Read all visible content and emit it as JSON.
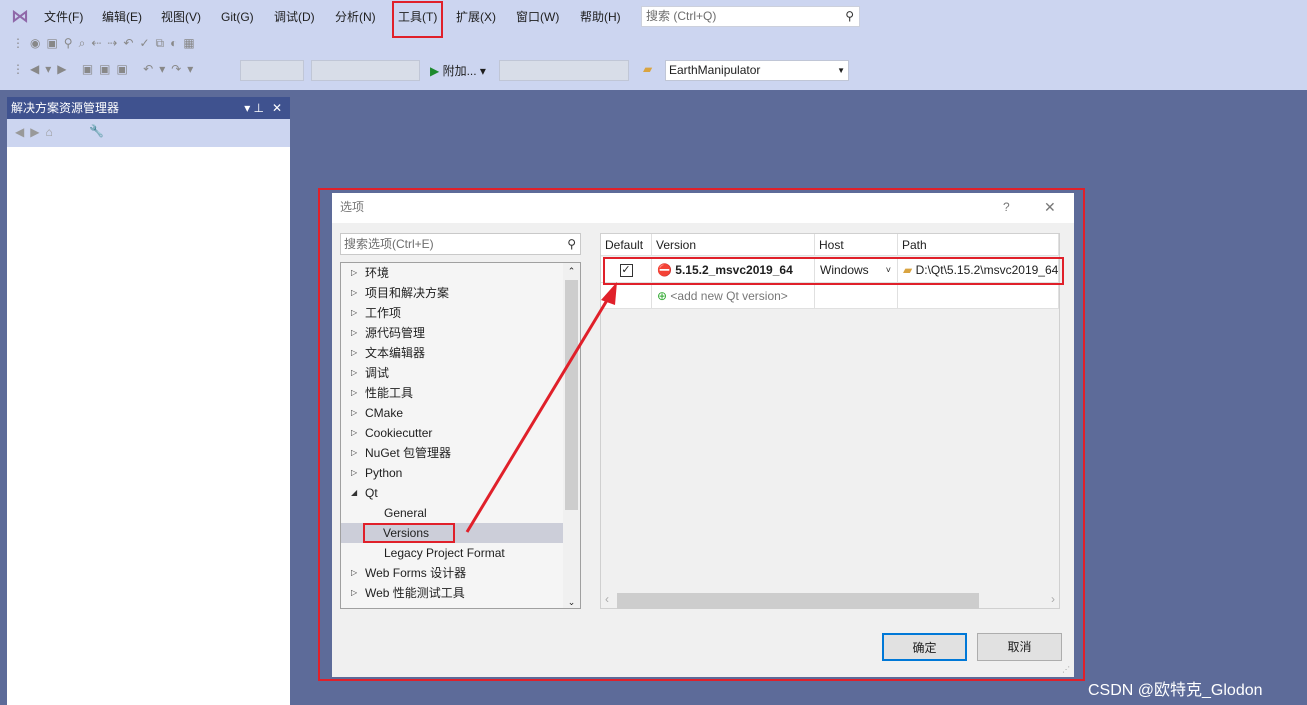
{
  "menu": [
    "文件(F)",
    "编辑(E)",
    "视图(V)",
    "Git(G)",
    "调试(D)",
    "分析(N)",
    "工具(T)",
    "扩展(X)",
    "窗口(W)",
    "帮助(H)"
  ],
  "search_placeholder": "搜索 (Ctrl+Q)",
  "toolbar": {
    "attach_label": "附加...",
    "startup_project": "EarthManipulator"
  },
  "solution_explorer": {
    "title": "解决方案资源管理器"
  },
  "dialog": {
    "title": "选项",
    "help": "?",
    "close": "✕",
    "search_placeholder": "搜索选项(Ctrl+E)",
    "tree": [
      {
        "label": "环境",
        "expanded": false
      },
      {
        "label": "项目和解决方案",
        "expanded": false
      },
      {
        "label": "工作项",
        "expanded": false
      },
      {
        "label": "源代码管理",
        "expanded": false
      },
      {
        "label": "文本编辑器",
        "expanded": false
      },
      {
        "label": "调试",
        "expanded": false
      },
      {
        "label": "性能工具",
        "expanded": false
      },
      {
        "label": "CMake",
        "expanded": false
      },
      {
        "label": "Cookiecutter",
        "expanded": false
      },
      {
        "label": "NuGet 包管理器",
        "expanded": false
      },
      {
        "label": "Python",
        "expanded": false
      },
      {
        "label": "Qt",
        "expanded": true
      },
      {
        "label": "General",
        "child": true
      },
      {
        "label": "Versions",
        "child": true,
        "selected": true
      },
      {
        "label": "Legacy Project Format",
        "child": true
      },
      {
        "label": "Web Forms 设计器",
        "expanded": false
      },
      {
        "label": "Web 性能测试工具",
        "expanded": false
      }
    ],
    "grid": {
      "headers": [
        "Default",
        "Version",
        "Host",
        "Path"
      ],
      "rows": [
        {
          "default": true,
          "version": "5.15.2_msvc2019_64",
          "host": "Windows",
          "path": "D:\\Qt\\5.15.2\\msvc2019_64"
        }
      ],
      "add_label": "<add new Qt version>"
    },
    "ok": "确定",
    "cancel": "取消"
  },
  "watermark": "CSDN @欧特克_Glodon",
  "colors": {
    "highlight": "#e0202a",
    "accent": "#0078d7"
  }
}
